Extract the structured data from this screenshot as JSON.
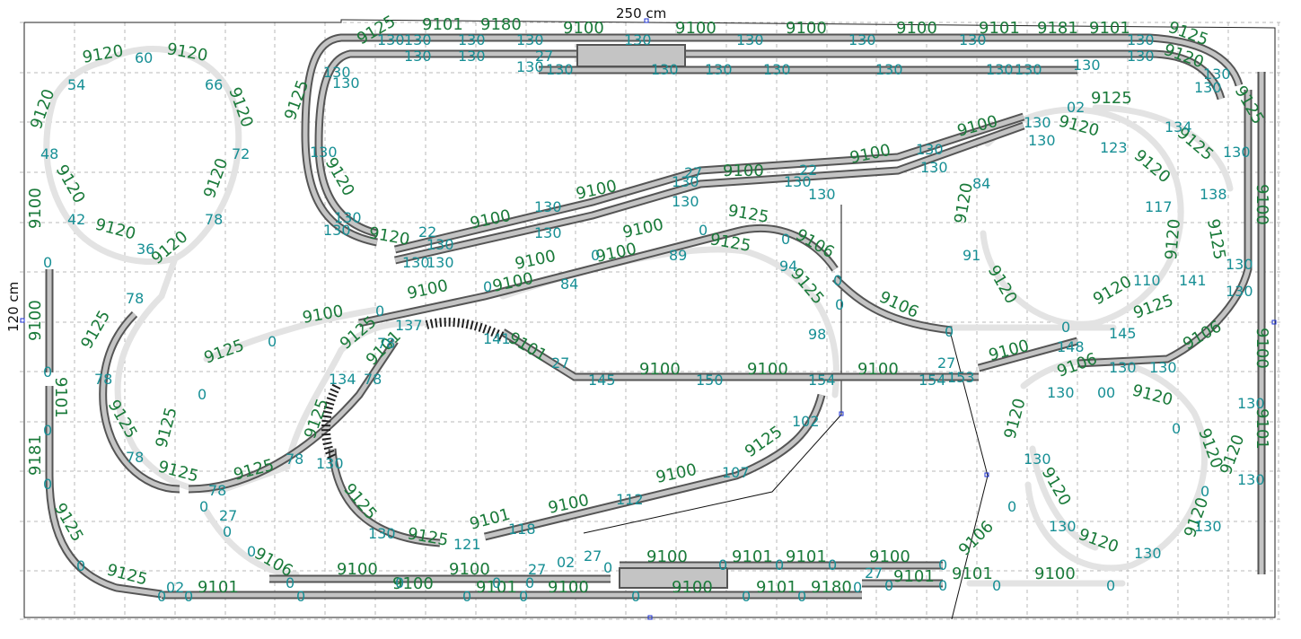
{
  "dimensions": {
    "width_label": "250 cm",
    "height_label": "120 cm"
  },
  "colors": {
    "track": "#555555",
    "track_fill": "#c4c4c4",
    "flex": "#e3e3e3",
    "grade_label": "#178f95",
    "part_label": "#1a7a3a",
    "grid": "#b9b9b9"
  },
  "part_labels": {
    "p9100": "9100",
    "p9101": "9101",
    "p9120": "9120",
    "p9125": "9125",
    "p9106": "9106",
    "p9180": "9180",
    "p9181": "9181"
  },
  "grade_labels": {
    "g0": "0",
    "g02": "02",
    "g27": "27",
    "g22": "22",
    "g36": "36",
    "g42": "42",
    "g48": "48",
    "g54": "54",
    "g60": "60",
    "g66": "66",
    "g72": "72",
    "g78": "78",
    "g84": "84",
    "g89": "89",
    "g91": "91",
    "g94": "94",
    "g98": "98",
    "g102": "102",
    "g107": "107",
    "g110": "110",
    "g112": "112",
    "g117": "117",
    "g118": "118",
    "g121": "121",
    "g123": "123",
    "g130": "130",
    "g134": "134",
    "g137": "137",
    "g138": "138",
    "g141": "141",
    "g145": "145",
    "g148": "148",
    "g150": "150",
    "g153": "153",
    "g154": "154"
  }
}
